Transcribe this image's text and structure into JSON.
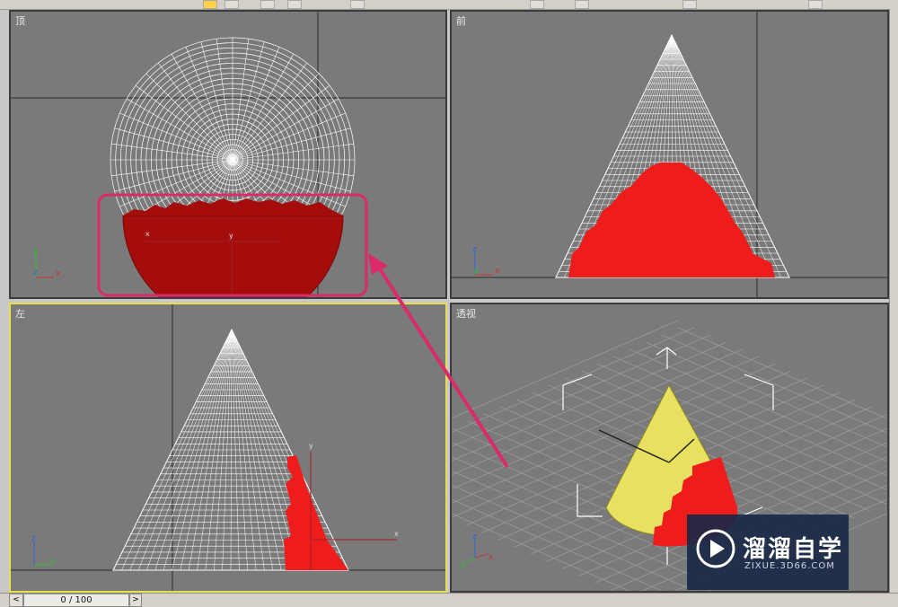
{
  "viewports": {
    "top": {
      "label": "顶"
    },
    "front": {
      "label": "前"
    },
    "left": {
      "label": "左"
    },
    "perspective": {
      "label": "透视"
    }
  },
  "axis_labels": {
    "x": "x",
    "y": "y",
    "z": "z"
  },
  "timeline": {
    "frame": "0 / 100",
    "prev": "<",
    "next": ">"
  },
  "watermark": {
    "title": "溜溜自学",
    "subtitle": "ZIXUE.3D66.COM"
  },
  "colors": {
    "viewport_bg": "#7a7a7a",
    "wire": "#ffffff",
    "selection_red": "#ee1c1c",
    "dark_red": "#a00c0c",
    "cone_yellow": "#e8e060",
    "highlight": "#d92a6a",
    "active_border": "#e8e04a"
  }
}
